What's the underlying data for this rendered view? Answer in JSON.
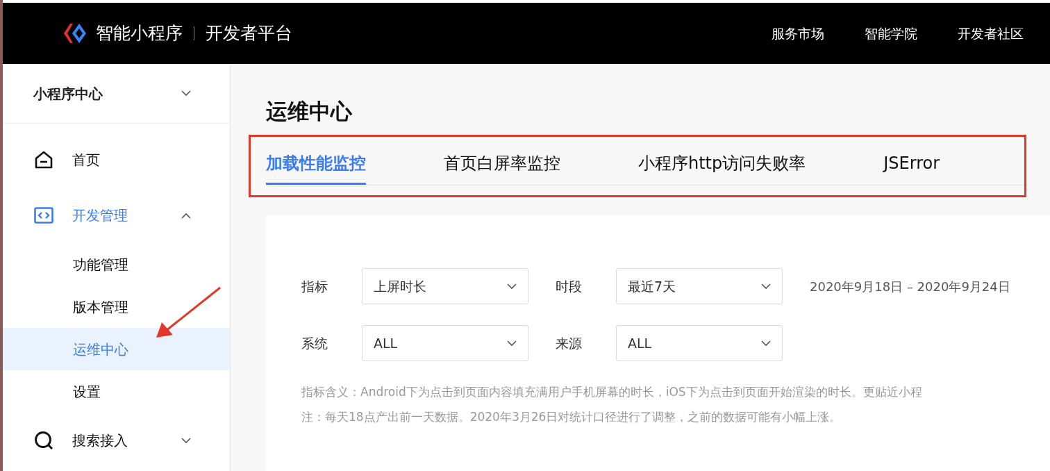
{
  "header": {
    "brand": "智能小程序",
    "platform": "开发者平台",
    "nav": [
      {
        "label": "服务市场"
      },
      {
        "label": "智能学院"
      },
      {
        "label": "开发者社区"
      }
    ]
  },
  "sidebar": {
    "switcher": {
      "label": "小程序中心",
      "expanded": false
    },
    "items": [
      {
        "label": "首页",
        "selected": false
      },
      {
        "label": "开发管理",
        "selected": false,
        "expanded": true,
        "children": [
          {
            "label": "功能管理",
            "selected": false
          },
          {
            "label": "版本管理",
            "selected": false
          },
          {
            "label": "运维中心",
            "selected": true
          },
          {
            "label": "设置",
            "selected": false
          }
        ]
      },
      {
        "label": "搜索接入",
        "selected": false,
        "expanded": false
      }
    ]
  },
  "page": {
    "title": "运维中心",
    "tabs": [
      {
        "label": "加载性能监控",
        "selected": true
      },
      {
        "label": "首页白屏率监控",
        "selected": false
      },
      {
        "label": "小程序http访问失败率",
        "selected": false
      },
      {
        "label": "JSError",
        "selected": false
      }
    ],
    "filters": [
      [
        {
          "label": "指标",
          "value": "上屏时长"
        },
        {
          "label": "时段",
          "value": "最近7天"
        }
      ],
      [
        {
          "label": "系统",
          "value": "ALL"
        },
        {
          "label": "来源",
          "value": "ALL"
        }
      ]
    ],
    "date_range": "2020年9月18日 – 2020年9月24日",
    "notes": [
      "指标含义：Android下为点击到页面内容填充满用户手机屏幕的时长，iOS下为点击到页面开始渲染的时长。更贴近小程",
      "注：每天18点产出前一天数据。2020年3月26日对统计口径进行了调整，之前的数据可能有小幅上涨。"
    ]
  }
}
